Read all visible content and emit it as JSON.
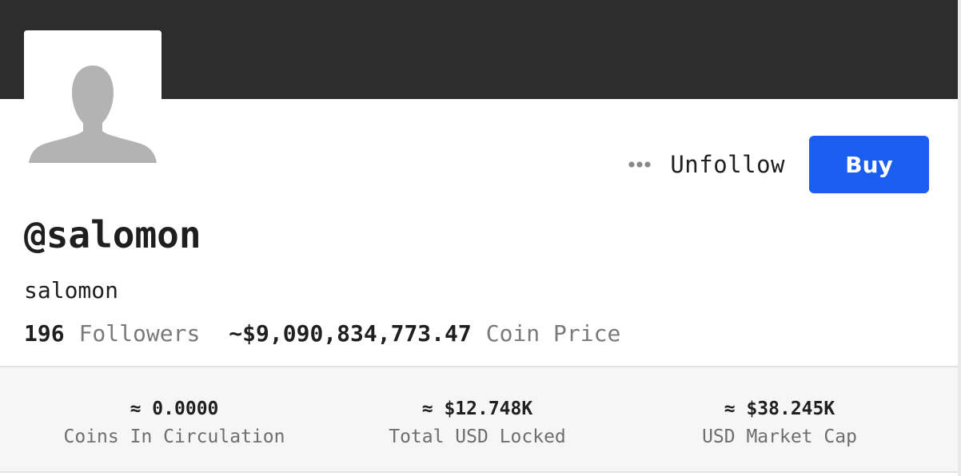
{
  "profile": {
    "handle": "@salomon",
    "display_name": "salomon",
    "avatar_icon": "default-user-silhouette-icon"
  },
  "actions": {
    "more_icon": "more-dots-icon",
    "unfollow_label": "Unfollow",
    "buy_label": "Buy"
  },
  "stats": {
    "followers_count": "196",
    "followers_label": "Followers",
    "coin_price": "~$9,090,834,773.47",
    "coin_price_label": "Coin Price"
  },
  "metrics": [
    {
      "value": "≈ 0.0000",
      "label": "Coins In Circulation"
    },
    {
      "value": "≈ $12.748K",
      "label": "Total USD Locked"
    },
    {
      "value": "≈ $38.245K",
      "label": "USD Market Cap"
    }
  ],
  "colors": {
    "banner": "#2d2d2d",
    "accent": "#1a5ef0",
    "metrics_background": "#f6f6f6"
  }
}
